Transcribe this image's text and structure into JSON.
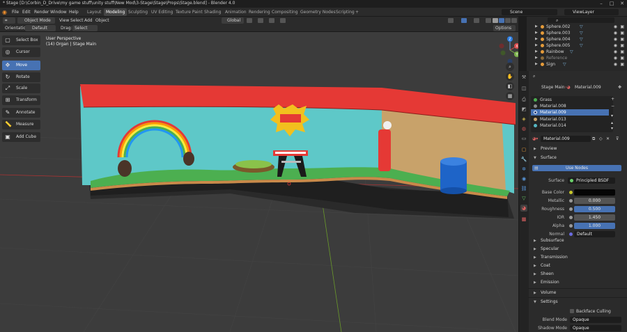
{
  "titlebar": {
    "title": "* Stage [D:\\Corbin_D_Drive\\my game stuff\\unity stuff\\New Mod\\3-Stage\\Stage\\Props\\Stage.blend] - Blender 4.0",
    "minimize": "–",
    "maximize": "□",
    "close": "✕"
  },
  "menu": [
    "File",
    "Edit",
    "Render",
    "Window",
    "Help"
  ],
  "workspaces": [
    "Layout",
    "Modeling",
    "Sculpting",
    "UV Editing",
    "Texture Paint",
    "Shading",
    "Animation",
    "Rendering",
    "Compositing",
    "Geometry Nodes",
    "Scripting"
  ],
  "active_workspace": "Modeling",
  "scene": "Scene",
  "view_layer": "ViewLayer",
  "viewport_header": {
    "mode": "Object Mode",
    "menus": [
      "View",
      "Select",
      "Add",
      "Object"
    ],
    "transform_orientation": "Global"
  },
  "tool_settings": {
    "orientation_label": "Orientation:",
    "orientation": "Default",
    "drag_label": "Drag:",
    "drag": "Select Box",
    "options": "Options"
  },
  "viewport": {
    "perspective": "User Perspective",
    "context": "(14) Organ | Stage Main",
    "gizmo_axes": {
      "x": "X",
      "y": "Y",
      "z": "Z"
    }
  },
  "tools": [
    "Select Box",
    "Cursor",
    "Move",
    "Rotate",
    "Scale",
    "Transform",
    "Annotate",
    "Measure",
    "Add Cube"
  ],
  "active_tool": "Move",
  "outliner": [
    {
      "name": "Sphere.002"
    },
    {
      "name": "Sphere.003"
    },
    {
      "name": "Sphere.004"
    },
    {
      "name": "Sphere.005"
    },
    {
      "name": "Rainbow"
    },
    {
      "name": "Reference"
    },
    {
      "name": "Sign"
    }
  ],
  "properties": {
    "breadcrumb_object": "Stage Main",
    "breadcrumb_material": "Material.009",
    "slots": [
      {
        "name": "Grass",
        "color": "#4caf50"
      },
      {
        "name": "Material.008",
        "color": "#888888"
      },
      {
        "name": "Material.009",
        "color": "#3a6fd8"
      },
      {
        "name": "Material.013",
        "color": "#c8a26a"
      },
      {
        "name": "Material.014",
        "color": "#56b6c2"
      }
    ],
    "active_slot": "Material.009",
    "material_name": "Material.009",
    "preview_label": "Preview",
    "surface_label": "Surface",
    "use_nodes": "Use Nodes",
    "surface_field_label": "Surface",
    "surface_shader": "Principled BSDF",
    "base_color_label": "Base Color",
    "metallic_label": "Metallic",
    "metallic": "0.000",
    "roughness_label": "Roughness",
    "roughness": "0.500",
    "ior_label": "IOR",
    "ior": "1.450",
    "alpha_label": "Alpha",
    "alpha": "1.000",
    "normal_label": "Normal",
    "normal": "Default",
    "subsections": [
      "Subsurface",
      "Specular",
      "Transmission",
      "Coat",
      "Sheen",
      "Emission"
    ],
    "volume_label": "Volume",
    "settings_label": "Settings",
    "backface_culling": "Backface Culling",
    "blend_mode_label": "Blend Mode",
    "blend_mode": "Opaque",
    "shadow_mode_label": "Shadow Mode",
    "shadow_mode": "Opaque"
  },
  "colors": {
    "accent": "#4772b3",
    "stage_wall": "#5ec8c8",
    "curtain": "#e53935",
    "grass": "#4caf50",
    "back_wall": "#c8a26a"
  }
}
